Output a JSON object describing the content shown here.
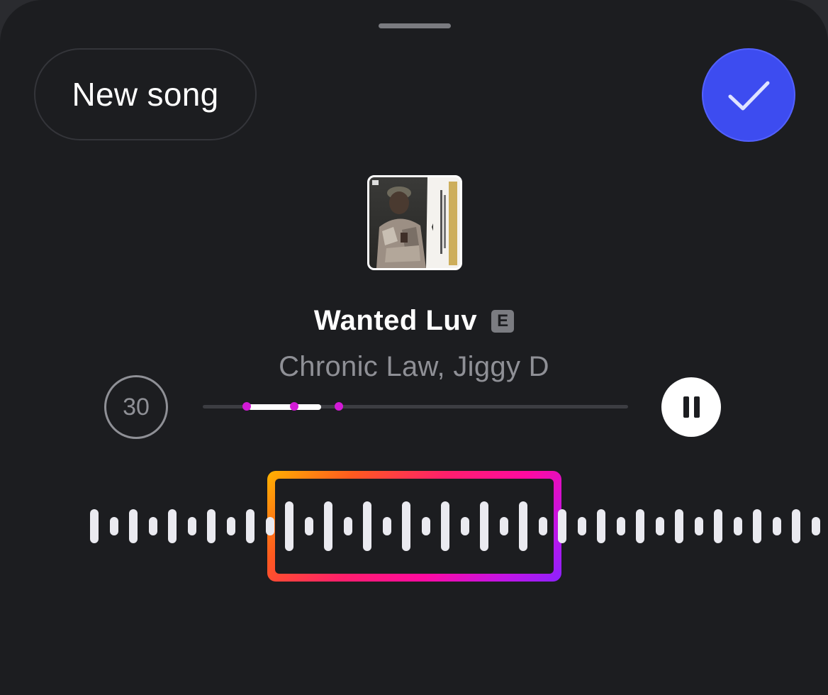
{
  "header": {
    "new_song_label": "New song",
    "done_icon": "checkmark-icon",
    "accent_color": "#3d4cf0"
  },
  "song": {
    "title": "Wanted Luv",
    "explicit_badge": "E",
    "artist": "Chronic Law, Jiggy D",
    "cover_icon": "album-cover"
  },
  "playback": {
    "duration_seconds": "30",
    "progress_fraction": 0.17,
    "state": "playing",
    "pause_icon": "pause-icon"
  },
  "selection": {
    "gradient_colors": [
      "#ffb300",
      "#ff1f6b",
      "#ff0aa0",
      "#8b22ff"
    ],
    "marker_color": "#d21ad6"
  }
}
